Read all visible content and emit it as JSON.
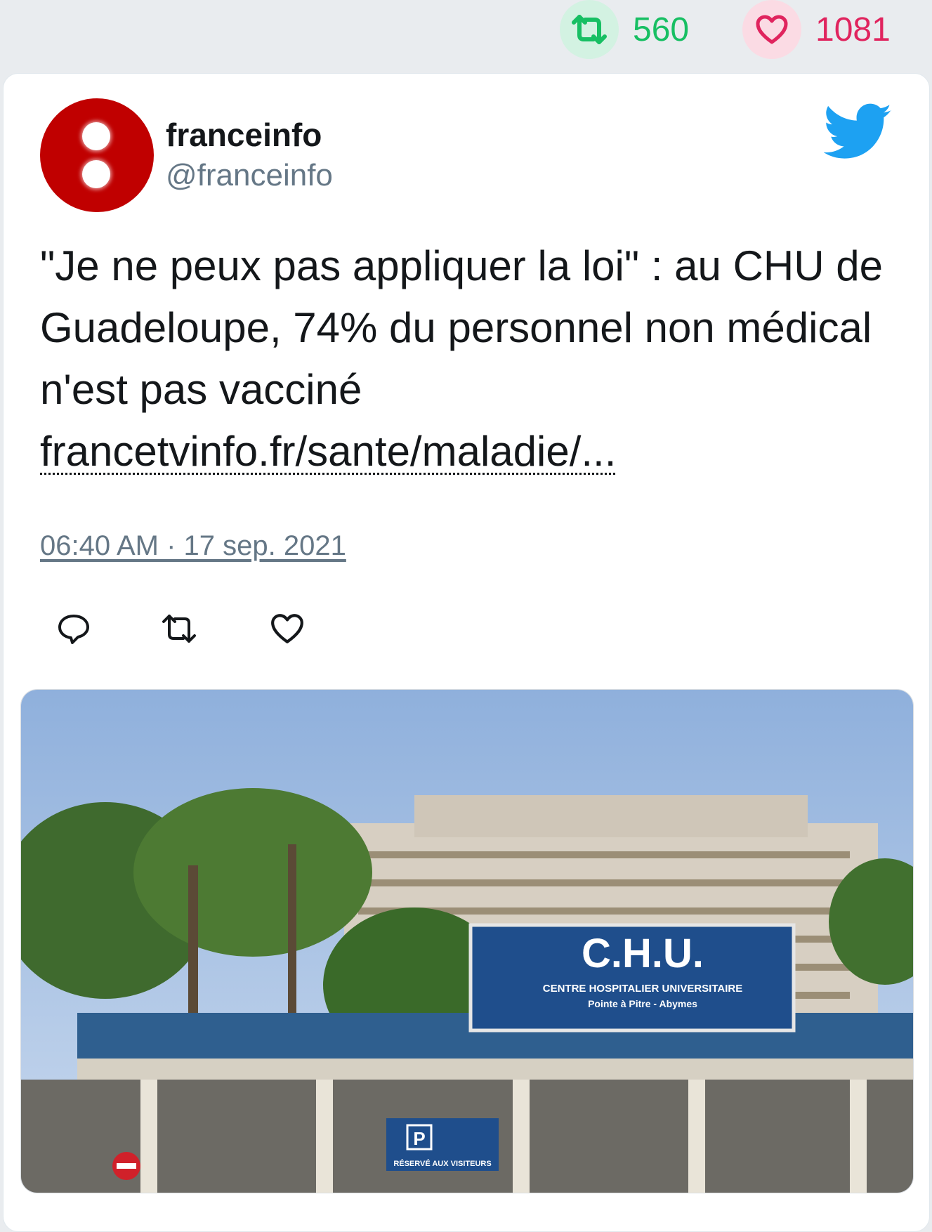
{
  "stats": {
    "retweets": "560",
    "likes": "1081",
    "retweet_icon": "retweet-icon",
    "like_icon": "heart-icon",
    "retweet_color": "#17bf63",
    "like_color": "#e0245e"
  },
  "tweet": {
    "author_name": "franceinfo",
    "author_handle": "@franceinfo",
    "text": "\"Je ne peux pas appliquer la loi\" : au CHU de Guadeloupe, 74% du personnel non médical n'est pas vacciné",
    "link": "francetvinfo.fr/sante/maladie/...",
    "timestamp": "06:40 AM · 17 sep. 2021",
    "brand_icon": "twitter-bird-icon",
    "actions": [
      "reply-icon",
      "retweet-icon",
      "like-icon"
    ]
  },
  "media": {
    "sign_title": "C.H.U.",
    "sign_line1": "CENTRE HOSPITALIER UNIVERSITAIRE",
    "sign_line2": "Pointe à Pitre - Abymes",
    "parking_letter": "P",
    "parking_text": "RÉSERVÉ AUX VISITEURS"
  }
}
